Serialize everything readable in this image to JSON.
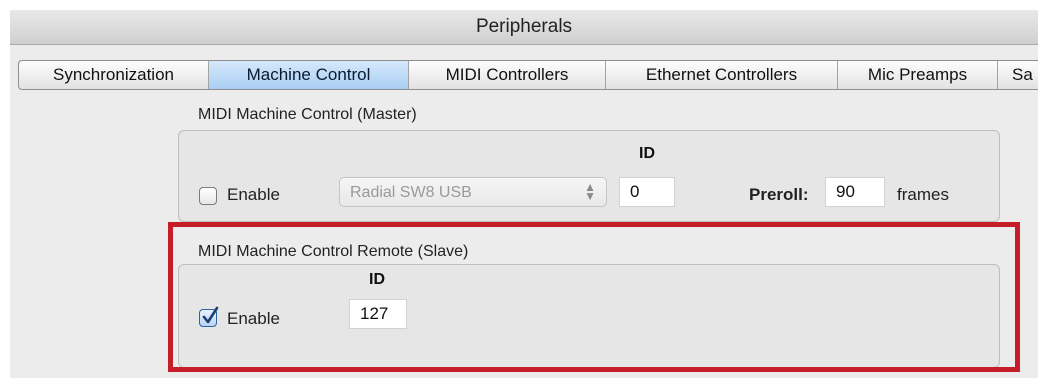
{
  "window": {
    "title": "Peripherals"
  },
  "tabs": [
    {
      "label": "Synchronization"
    },
    {
      "label": "Machine Control"
    },
    {
      "label": "MIDI Controllers"
    },
    {
      "label": "Ethernet Controllers"
    },
    {
      "label": "Mic Preamps"
    },
    {
      "label": "Sa"
    }
  ],
  "active_tab": "Machine Control",
  "master": {
    "section_label": "MIDI Machine Control (Master)",
    "enable_label": "Enable",
    "enabled": false,
    "device": "Radial SW8 USB",
    "id_label": "ID",
    "id_value": "0",
    "preroll_label": "Preroll:",
    "preroll_value": "90",
    "preroll_unit": "frames"
  },
  "remote": {
    "section_label": "MIDI Machine Control Remote (Slave)",
    "enable_label": "Enable",
    "enabled": true,
    "id_label": "ID",
    "id_value": "127"
  },
  "colors": {
    "highlight": "#c61e28",
    "active_tab": "#a9cff4"
  }
}
